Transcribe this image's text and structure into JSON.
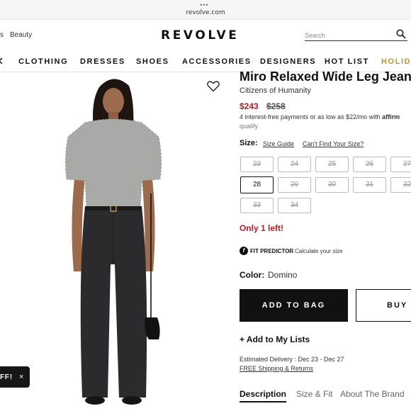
{
  "browser": {
    "url": "revolve.com"
  },
  "header": {
    "left_links": [
      "s",
      "Beauty"
    ],
    "logo": "REVOLVE",
    "search_placeholder": "Search"
  },
  "nav": {
    "items": [
      "CLOTHING",
      "DRESSES",
      "SHOES",
      "ACCESSORIES",
      "DESIGNERS",
      "HOT LIST",
      "HOLIDA"
    ]
  },
  "promo": {
    "label": "FF!",
    "close": "×"
  },
  "product": {
    "title": "Miro Relaxed Wide Leg Jean",
    "brand": "Citizens of Humanity",
    "price": "$243",
    "original_price": "$258",
    "installments": "4 interest-free payments or as low as $22/mo with",
    "installments_provider": "affirm",
    "qualify": "qualify",
    "size_label": "Size:",
    "size_guide": "Size Guide",
    "cant_find_size": "Can't Find Your Size?",
    "sizes": [
      {
        "label": "23",
        "available": false
      },
      {
        "label": "24",
        "available": false
      },
      {
        "label": "25",
        "available": false
      },
      {
        "label": "26",
        "available": false
      },
      {
        "label": "27",
        "available": false
      },
      {
        "label": "28",
        "available": true
      },
      {
        "label": "29",
        "available": false
      },
      {
        "label": "30",
        "available": false
      },
      {
        "label": "31",
        "available": false
      },
      {
        "label": "32",
        "available": false
      },
      {
        "label": "33",
        "available": false
      },
      {
        "label": "34",
        "available": false
      }
    ],
    "stock_message": "Only 1 left!",
    "fit_predictor_icon": "f",
    "fit_predictor": "FIT PREDICTOR",
    "fit_predictor_cta": "Calculate your size",
    "color_label": "Color:",
    "color_value": "Domino",
    "add_to_bag": "ADD TO BAG",
    "buy_now": "BUY N",
    "add_to_lists": "+ Add to My Lists",
    "estimated_delivery": "Estimated Delivery : Dec 23 - Dec 27",
    "shipping": "FREE Shipping & Returns",
    "tabs": [
      "Description",
      "Size & Fit",
      "About The Brand"
    ]
  }
}
